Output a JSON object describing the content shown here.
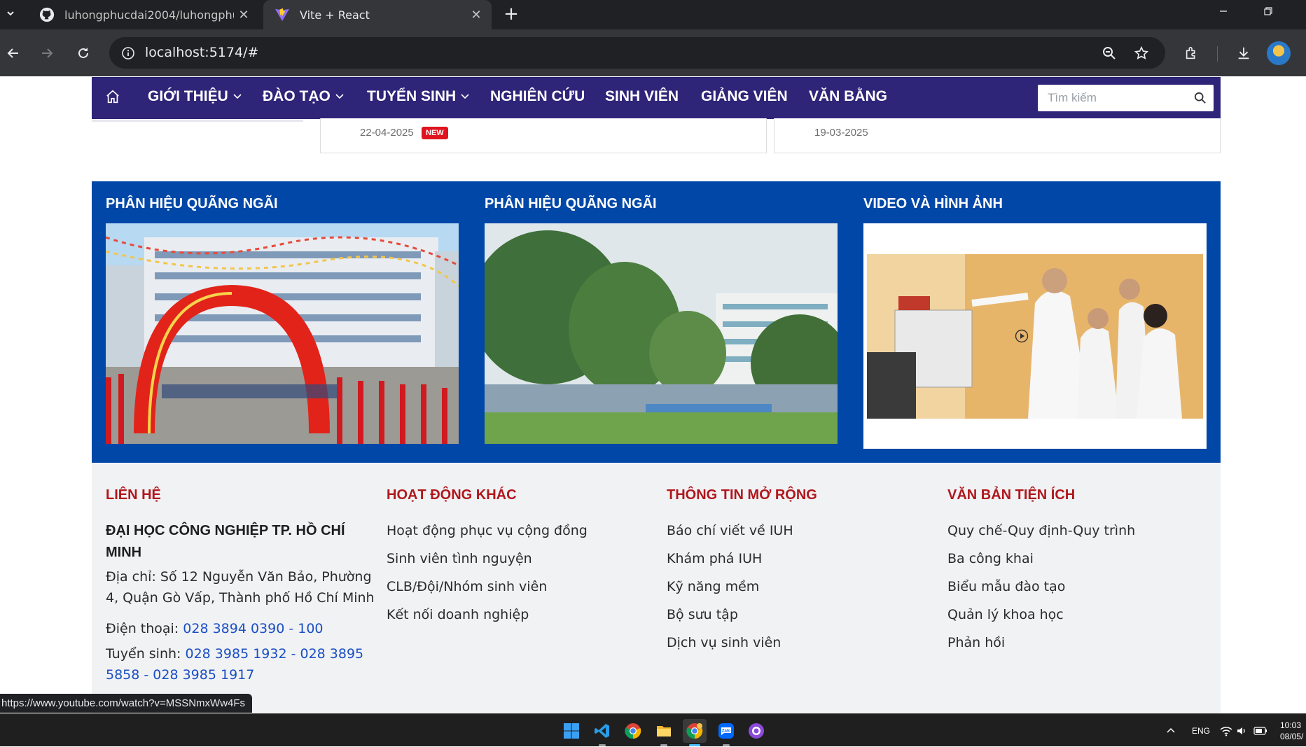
{
  "browser": {
    "tabs": [
      {
        "title": "luhongphucdai2004/luhongphucdai",
        "active": false,
        "favicon": "github-icon"
      },
      {
        "title": "Vite + React",
        "active": true,
        "favicon": "vite-icon"
      }
    ],
    "url": "localhost:5174/#"
  },
  "nav": {
    "items": [
      {
        "label": "GIỚI THIỆU",
        "dropdown": true
      },
      {
        "label": "ĐÀO TẠO",
        "dropdown": true
      },
      {
        "label": "TUYỂN SINH",
        "dropdown": true
      },
      {
        "label": "NGHIÊN CỨU",
        "dropdown": false
      },
      {
        "label": "SINH VIÊN",
        "dropdown": false
      },
      {
        "label": "GIẢNG VIÊN",
        "dropdown": false
      },
      {
        "label": "VĂN BẰNG",
        "dropdown": false
      }
    ],
    "search_placeholder": "Tìm kiếm"
  },
  "news": [
    {
      "date": "22-04-2025",
      "badge": "NEW"
    },
    {
      "date": "19-03-2025"
    }
  ],
  "media": [
    {
      "title": "PHÂN HIỆU QUÃNG NGÃI",
      "photo": "campus-gate-photo"
    },
    {
      "title": "PHÂN HIỆU QUÃNG NGÃI",
      "photo": "campus-trees-photo"
    },
    {
      "title": "VIDEO VÀ HÌNH ẢNH",
      "photo": "lab-video-thumbnail"
    }
  ],
  "footer": {
    "contact": {
      "heading": "LIÊN HỆ",
      "school_line1": "ĐẠI HỌC CÔNG NGHIỆP TP. HỒ CHÍ",
      "school_line2": "MINH",
      "address_line1": "Địa chỉ: Số 12 Nguyễn Văn Bảo, Phường",
      "address_line2": "4, Quận Gò Vấp, Thành phố Hồ Chí Minh",
      "phone_label": "Điện thoại:",
      "phone_value": "028 3894 0390 - 100",
      "admission_label": "Tuyển sinh:",
      "admission_value_line1": "028 3985 1932 - 028 3895",
      "admission_value_line2": "5858 - 028 3985 1917"
    },
    "columns": [
      {
        "heading": "HOẠT ĐỘNG KHÁC",
        "links": [
          "Hoạt động phục vụ cộng đồng",
          "Sinh viên tình nguyện",
          "CLB/Đội/Nhóm sinh viên",
          "Kết nối doanh nghiệp"
        ]
      },
      {
        "heading": "THÔNG TIN MỞ RỘNG",
        "links": [
          "Báo chí viết về IUH",
          "Khám phá IUH",
          "Kỹ năng mềm",
          "Bộ sưu tập",
          "Dịch vụ sinh viên"
        ]
      },
      {
        "heading": "VĂN BẢN TIỆN ÍCH",
        "links": [
          "Quy chế-Quy định-Quy trình",
          "Ba công khai",
          "Biểu mẫu đào tạo",
          "Quản lý khoa học",
          "Phản hồi"
        ]
      }
    ]
  },
  "status_url": "https://www.youtube.com/watch?v=MSSNmxWw4Fs",
  "taskbar": {
    "apps": [
      "windows-start-icon",
      "vscode-icon",
      "chrome-icon",
      "file-explorer-icon",
      "chrome-profile-icon",
      "zalo-icon",
      "github-desktop-icon"
    ],
    "language": "ENG",
    "time": "10:03",
    "date": "08/05/"
  },
  "colors": {
    "nav": "#2e2478",
    "media_bg": "#0047a8",
    "footer_heading": "#b0171c",
    "link_blue": "#1a4fc4",
    "badge": "#e0141e"
  }
}
